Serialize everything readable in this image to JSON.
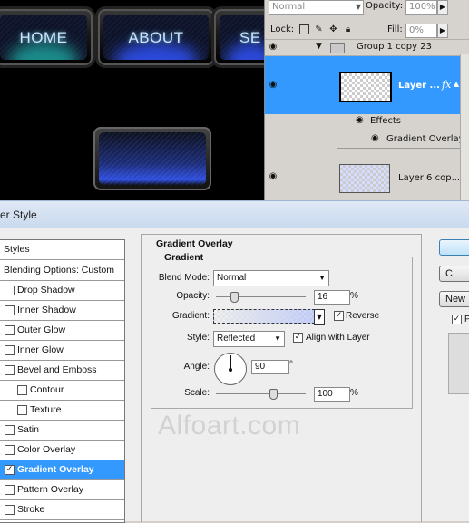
{
  "canvas": {
    "nav_buttons": [
      "HOME",
      "ABOUT",
      "SE"
    ]
  },
  "layers_panel": {
    "blend_mode": "Normal",
    "opacity_label": "Opacity:",
    "opacity_value": "100%",
    "lock_label": "Lock:",
    "fill_label": "Fill:",
    "fill_value": "0%",
    "group_name": "Group 1 copy 23",
    "selected_layer_name": "Layer ...",
    "effects_label": "Effects",
    "effect_item": "Gradient Overlay",
    "next_layer_name": "Layer 6 cop..."
  },
  "dialog": {
    "title": "yer Style",
    "styles_header": "Styles",
    "blending_options": "Blending Options: Custom",
    "items": [
      {
        "label": "Drop Shadow",
        "checked": false,
        "indent": false
      },
      {
        "label": "Inner Shadow",
        "checked": false,
        "indent": false
      },
      {
        "label": "Outer Glow",
        "checked": false,
        "indent": false
      },
      {
        "label": "Inner Glow",
        "checked": false,
        "indent": false
      },
      {
        "label": "Bevel and Emboss",
        "checked": false,
        "indent": false
      },
      {
        "label": "Contour",
        "checked": false,
        "indent": true
      },
      {
        "label": "Texture",
        "checked": false,
        "indent": true
      },
      {
        "label": "Satin",
        "checked": false,
        "indent": false
      },
      {
        "label": "Color Overlay",
        "checked": false,
        "indent": false
      },
      {
        "label": "Gradient Overlay",
        "checked": true,
        "indent": false,
        "active": true
      },
      {
        "label": "Pattern Overlay",
        "checked": false,
        "indent": false
      },
      {
        "label": "Stroke",
        "checked": false,
        "indent": false
      }
    ],
    "section_title": "Gradient Overlay",
    "group_title": "Gradient",
    "blend_mode_label": "Blend Mode:",
    "blend_mode_value": "Normal",
    "opacity_label": "Opacity:",
    "opacity_value": "16",
    "opacity_unit": "%",
    "opacity_level": 0.16,
    "gradient_label": "Gradient:",
    "reverse_label": "Reverse",
    "reverse_checked": true,
    "style_label": "Style:",
    "style_value": "Reflected",
    "align_label": "Align with Layer",
    "align_checked": true,
    "angle_label": "Angle:",
    "angle_value": "90",
    "angle_unit": "°",
    "scale_label": "Scale:",
    "scale_value": "100",
    "scale_unit": "%",
    "scale_level": 1.0,
    "buttons": {
      "ok": "",
      "cancel": "C",
      "new_style": "New"
    },
    "preview_label": "P",
    "preview_checked": true
  },
  "watermark": "Alfoart.com",
  "colors": {
    "selection": "#3399ff",
    "button_glow_teal": "#1b8a8a",
    "button_glow_blue": "#2b49d8"
  }
}
